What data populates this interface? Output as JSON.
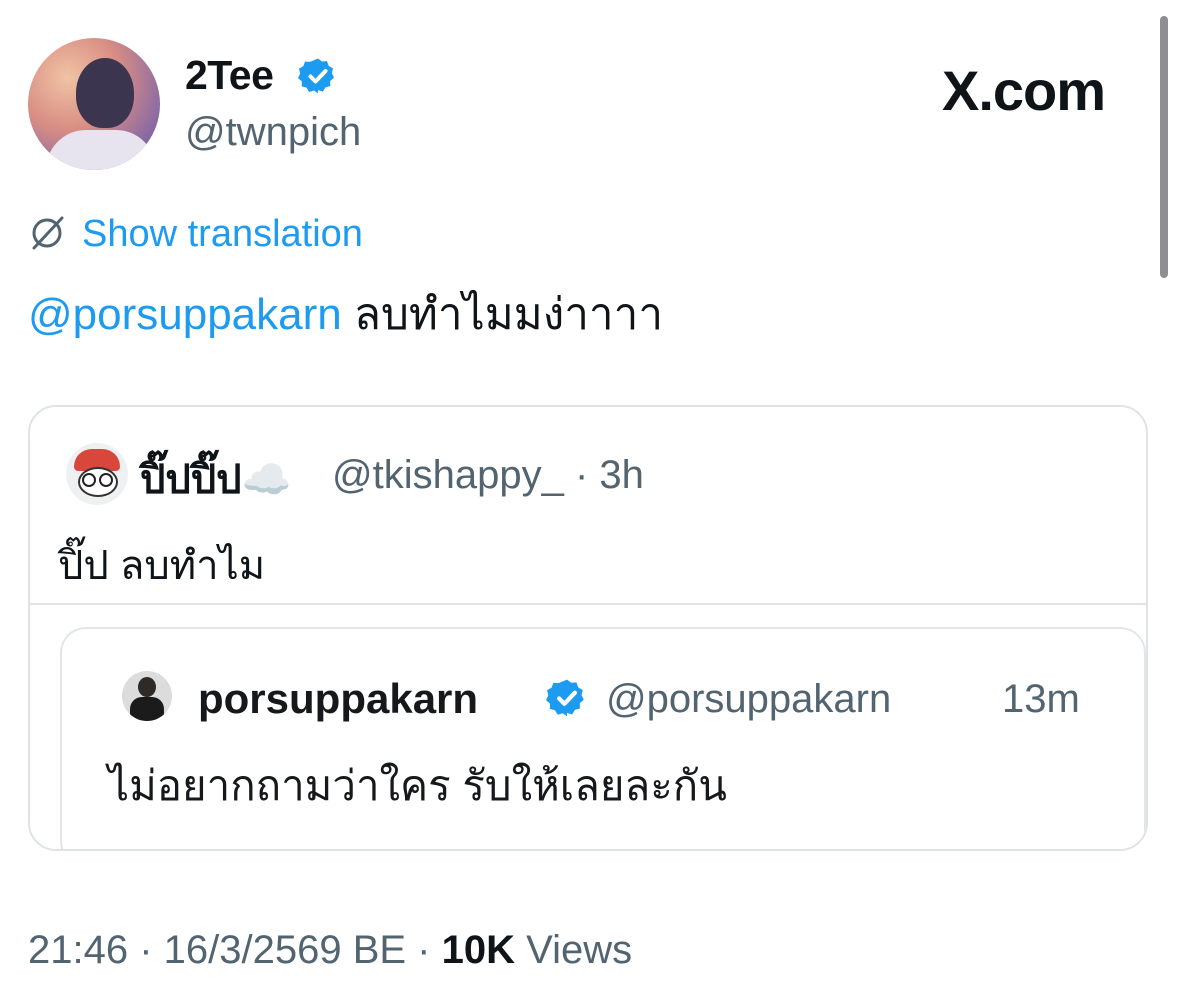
{
  "author": {
    "display_name": "2Tee",
    "handle": "@twnpich",
    "verified": true
  },
  "brand_text": "X.com",
  "translation_link": "Show translation",
  "tweet": {
    "mention": "@porsuppakarn",
    "text": "ลบทำไมมง่าาาา"
  },
  "quoted_tweet": {
    "display_name": "ปิ๊ปปิ๊ป☁️",
    "handle_time": "@tkishappy_ · 3h",
    "text": "ปิ๊ป ลบทำไม",
    "embedded_screenshot": {
      "display_name": "porsuppakarn",
      "handle": "@porsuppakarn",
      "time": "13m",
      "text": "ไม่อยากถามว่าใคร รับให้เลยละกัน"
    }
  },
  "footer": {
    "time_date": "21:46 · 16/3/2569 BE · ",
    "views_count": "10K",
    "views_label": " Views"
  },
  "icons": {
    "verified": "verified-badge-icon",
    "translate": "globe-slash-icon"
  },
  "colors": {
    "accent": "#1d9bf0",
    "muted": "#536471",
    "text": "#0f1419",
    "border": "#dfe3e7"
  }
}
